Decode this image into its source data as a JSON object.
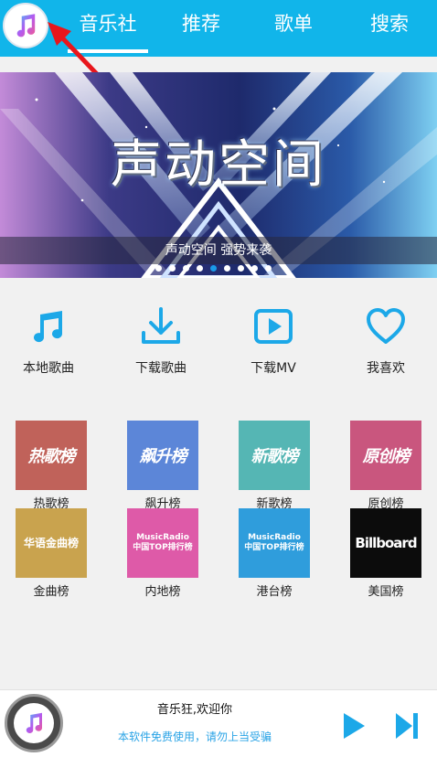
{
  "header": {
    "tabs": [
      {
        "label": "音乐社"
      },
      {
        "label": "推荐"
      },
      {
        "label": "歌单"
      },
      {
        "label": "搜索"
      }
    ],
    "app_icon": "music-note-icon"
  },
  "banner": {
    "title": "声动空间",
    "caption": "声动空间 强势来袭",
    "dot_count": 9,
    "active_dot": 4
  },
  "quick_actions": [
    {
      "label": "本地歌曲",
      "icon": "music-note-icon"
    },
    {
      "label": "下载歌曲",
      "icon": "download-icon"
    },
    {
      "label": "下载MV",
      "icon": "video-play-icon"
    },
    {
      "label": "我喜欢",
      "icon": "heart-icon"
    }
  ],
  "charts": [
    {
      "label": "热歌榜",
      "tile_text": "热歌榜",
      "color": "#c0625a"
    },
    {
      "label": "飙升榜",
      "tile_text": "飙升榜",
      "color": "#5c86d8"
    },
    {
      "label": "新歌榜",
      "tile_text": "新歌榜",
      "color": "#55b6b4"
    },
    {
      "label": "原创榜",
      "tile_text": "原创榜",
      "color": "#c9567e"
    },
    {
      "label": "金曲榜",
      "tile_text": "华语金曲榜",
      "color": "#c9a34e"
    },
    {
      "label": "内地榜",
      "tile_text_1": "MusicRadio",
      "tile_text_2": "中国TOP排行榜",
      "color": "#de5aa8"
    },
    {
      "label": "港台榜",
      "tile_text_1": "MusicRadio",
      "tile_text_2": "中国TOP排行榜",
      "color": "#2f9ddc"
    },
    {
      "label": "美国榜",
      "tile_text": "Billboard",
      "color": "#0c0c0c"
    }
  ],
  "player": {
    "title": "音乐狂,欢迎你",
    "subtitle": "本软件免费使用，请勿上当受骗",
    "accent": "#29a3e6"
  },
  "colors": {
    "header": "#11b5ea",
    "accent": "#1a9be8",
    "arrow": "#e8161c"
  }
}
